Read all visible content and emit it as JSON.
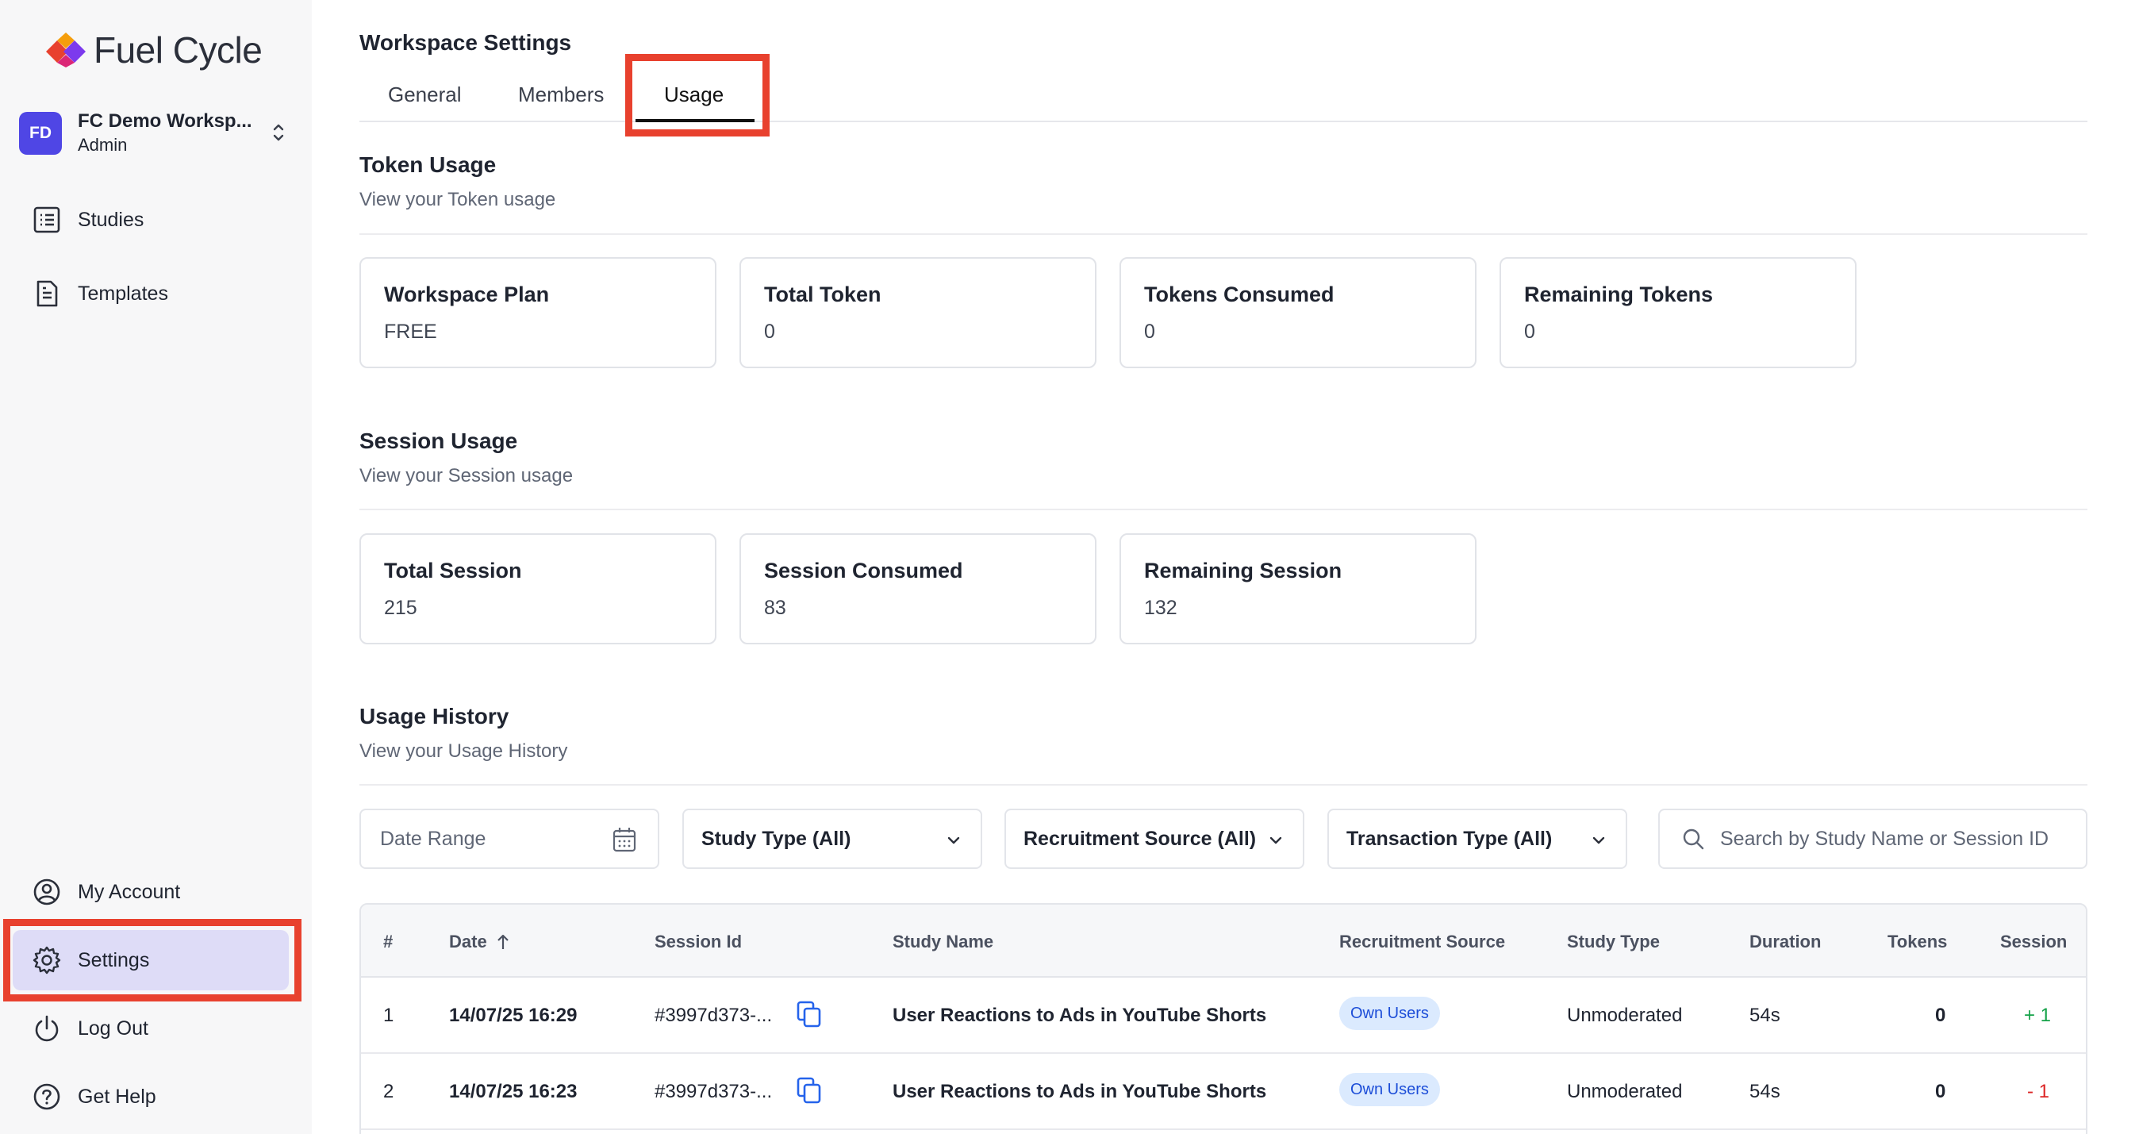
{
  "brand": {
    "name": "Fuel Cycle"
  },
  "workspace": {
    "initials": "FD",
    "name": "FC Demo Worksp...",
    "role": "Admin"
  },
  "nav": {
    "studies": "Studies",
    "templates": "Templates",
    "my_account": "My Account",
    "settings": "Settings",
    "log_out": "Log Out",
    "get_help": "Get Help"
  },
  "page": {
    "title": "Workspace Settings",
    "tabs": [
      "General",
      "Members",
      "Usage"
    ],
    "active_tab": "Usage"
  },
  "token_usage": {
    "title": "Token Usage",
    "subtitle": "View your Token usage",
    "cards": [
      {
        "label": "Workspace Plan",
        "value": "FREE"
      },
      {
        "label": "Total Token",
        "value": "0"
      },
      {
        "label": "Tokens Consumed",
        "value": "0"
      },
      {
        "label": "Remaining Tokens",
        "value": "0"
      }
    ]
  },
  "session_usage": {
    "title": "Session Usage",
    "subtitle": "View your Session usage",
    "cards": [
      {
        "label": "Total Session",
        "value": "215"
      },
      {
        "label": "Session Consumed",
        "value": "83"
      },
      {
        "label": "Remaining Session",
        "value": "132"
      }
    ]
  },
  "usage_history": {
    "title": "Usage History",
    "subtitle": "View your Usage History",
    "filters": {
      "date_range_placeholder": "Date Range",
      "study_type": "Study Type (All)",
      "recruitment_source": "Recruitment Source (All)",
      "transaction_type": "Transaction Type (All)",
      "search_placeholder": "Search by Study Name or Session ID"
    },
    "columns": [
      "#",
      "Date",
      "Session Id",
      "Study Name",
      "Recruitment Source",
      "Study Type",
      "Duration",
      "Tokens",
      "Session"
    ],
    "rows": [
      {
        "num": "1",
        "date": "14/07/25 16:29",
        "session_id": "#3997d373-...",
        "study_name": "User Reactions to Ads in YouTube Shorts",
        "recruitment_source": "Own Users",
        "study_type": "Unmoderated",
        "duration": "54s",
        "tokens": "0",
        "session": "+ 1"
      },
      {
        "num": "2",
        "date": "14/07/25 16:23",
        "session_id": "#3997d373-...",
        "study_name": "User Reactions to Ads in YouTube Shorts",
        "recruitment_source": "Own Users",
        "study_type": "Unmoderated",
        "duration": "54s",
        "tokens": "0",
        "session": "- 1"
      }
    ]
  },
  "colors": {
    "accent": "#4f46e5",
    "highlight": "#e8412e",
    "active_nav": "#dedcf7",
    "badge_bg": "#dbeafe",
    "positive": "#16a34a",
    "negative": "#dc2626"
  }
}
